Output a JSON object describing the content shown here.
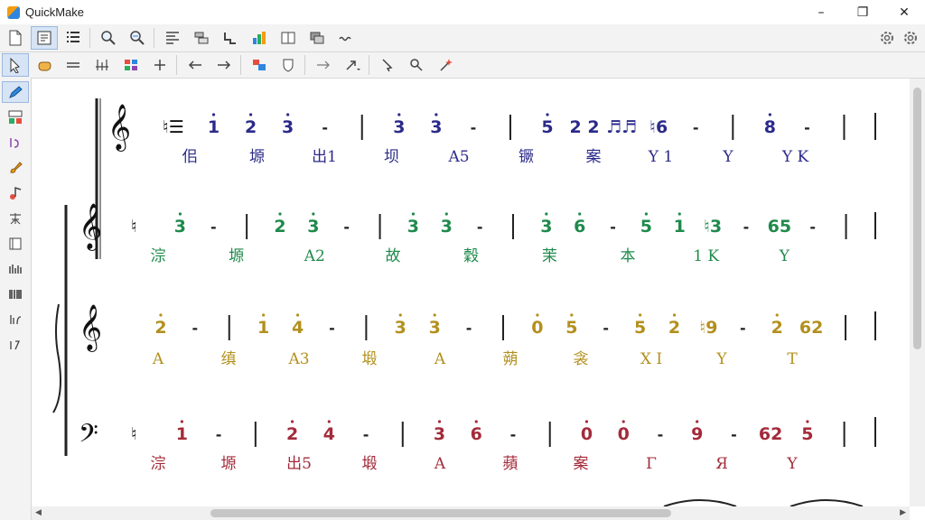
{
  "app": {
    "title": "QuickMake"
  },
  "window": {
    "minimize": "–",
    "maximize": "❐",
    "close": "✕"
  },
  "colors": {
    "line1": "#2b2a8a",
    "line2": "#1f8a4c",
    "line3": "#b3901e",
    "line4": "#a32b3a"
  },
  "score": {
    "staff1": {
      "prefix": "♮☰",
      "notes": [
        "1",
        "2",
        "3",
        "-",
        "|",
        "3",
        "3",
        "-",
        "|",
        "5",
        "2 2",
        "♬♬",
        "♮6",
        "-",
        "|",
        "8",
        "-",
        "|"
      ],
      "lyrics": [
        "佀",
        "塬",
        "出1",
        "坝",
        "A5",
        "镢",
        "案",
        "Y 1",
        "Y",
        "Y K"
      ]
    },
    "staff2": {
      "prefix": "♮",
      "notes": [
        "3",
        "-",
        "|",
        "2",
        "3",
        "-",
        "|",
        "3",
        "3",
        "-",
        "|",
        "3",
        "6",
        "-",
        "5",
        "1",
        "♮3",
        "-",
        "65",
        "-",
        "|"
      ],
      "lyrics": [
        "淙",
        "塬",
        "A2",
        "故",
        "穀",
        "茉",
        "本",
        "1 K",
        "Y"
      ]
    },
    "staff3": {
      "notes": [
        "2",
        "-",
        "|",
        "1",
        "4",
        "-",
        "|",
        "3",
        "3",
        "-",
        "|",
        "0",
        "5",
        "-",
        "5",
        "2",
        "♮9",
        "-",
        "2",
        "62",
        "|"
      ],
      "lyrics": [
        "A",
        "缜",
        "A3",
        "塅",
        "A",
        "蒴",
        "衾",
        "X I",
        "Y",
        "T"
      ]
    },
    "staff4": {
      "prefix": "♮",
      "notes": [
        "1",
        "-",
        "|",
        "2",
        "4",
        "-",
        "|",
        "3",
        "6",
        "-",
        "|",
        "0",
        "0",
        "-",
        "9",
        "-",
        "62",
        "5",
        "|"
      ],
      "lyrics": [
        "淙",
        "塬",
        "出5",
        "塅",
        "A",
        "蘋",
        "案",
        "Γ",
        "Я",
        "Y"
      ]
    }
  }
}
